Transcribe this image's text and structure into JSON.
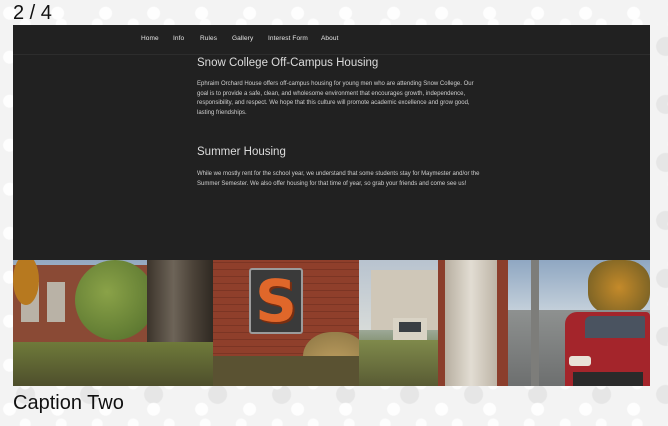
{
  "slideshow": {
    "counter": "2 / 4",
    "caption": "Caption Two"
  },
  "nav": {
    "items": [
      {
        "label": "Home"
      },
      {
        "label": "Info"
      },
      {
        "label": "Rules"
      },
      {
        "label": "Gallery"
      },
      {
        "label": "Interest Form"
      },
      {
        "label": "About"
      }
    ]
  },
  "content": {
    "section1": {
      "heading": "Snow College Off-Campus Housing",
      "body": "Ephraim Orchard House offers off-campus housing for young men who are attending Snow College. Our goal is to provide a safe, clean, and wholesome environment that encourages growth, independence, responsibility, and respect. We hope that this culture will promote academic excellence and grow good, lasting friendships."
    },
    "section2": {
      "heading": "Summer Housing",
      "body": "While we mostly rent for the school year, we understand that some students stay for Maymester and/or the Summer Semester. We also offer housing for that time of year, so grab your friends and come see us!"
    },
    "photo": {
      "sign_letter": "S"
    }
  },
  "colors": {
    "slide_background": "#212121",
    "sign_orange": "#e0672a",
    "brick": "#8f3f2b",
    "car_red": "#a4252b"
  }
}
